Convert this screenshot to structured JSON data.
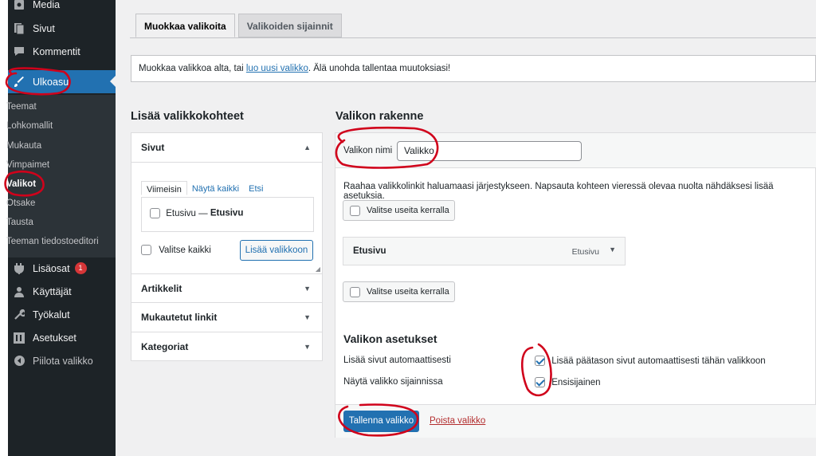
{
  "sidebar": {
    "items": [
      {
        "label": "Media",
        "icon": "media-icon"
      },
      {
        "label": "Sivut",
        "icon": "pages-icon"
      },
      {
        "label": "Kommentit",
        "icon": "comments-icon"
      },
      {
        "label": "Ulkoasu",
        "icon": "appearance-brush-icon"
      },
      {
        "label": "Lisäosat",
        "icon": "plugins-icon",
        "badge": "1"
      },
      {
        "label": "Käyttäjät",
        "icon": "users-icon"
      },
      {
        "label": "Työkalut",
        "icon": "tools-icon"
      },
      {
        "label": "Asetukset",
        "icon": "settings-icon"
      },
      {
        "label": "Piilota valikko",
        "icon": "collapse-menu-icon"
      }
    ],
    "submenu": [
      "Teemat",
      "Lohkomallit",
      "Mukauta",
      "Vimpaimet",
      "Valikot",
      "Otsake",
      "Tausta",
      "Teeman tiedostoeditori"
    ]
  },
  "tabs": [
    "Muokkaa valikoita",
    "Valikoiden sijainnit"
  ],
  "notice": {
    "before": "Muokkaa valikkoa alta, tai ",
    "link": "luo uusi valikko",
    "after": ". Älä unohda tallentaa muutoksiasi!"
  },
  "add_items": {
    "heading": "Lisää valikkokohteet",
    "sections": [
      "Sivut",
      "Artikkelit",
      "Mukautetut linkit",
      "Kategoriat"
    ],
    "inner_tabs": [
      "Viimeisin",
      "Näytä kaikki",
      "Etsi"
    ],
    "page_item_prefix": "Etusivu — ",
    "page_item_bold": "Etusivu",
    "select_all": "Valitse kaikki",
    "add_button": "Lisää valikkoon"
  },
  "structure": {
    "heading": "Valikon rakenne",
    "name_label": "Valikon nimi",
    "name_value": "Valikko",
    "instructions": "Raahaa valikkolinkit haluamaasi järjestykseen. Napsauta kohteen vieressä olevaa nuolta nähdäksesi lisää asetuksia.",
    "bulk_select": "Valitse useita kerralla",
    "menu_item_title": "Etusivu",
    "menu_item_type": "Etusivu"
  },
  "settings": {
    "heading": "Valikon asetukset",
    "auto_add_label": "Lisää sivut automaattisesti",
    "auto_add_option": "Lisää päätason sivut automaattisesti tähän valikkoon",
    "locations_label": "Näytä valikko sijainnissa",
    "location_option": "Ensisijainen"
  },
  "footer": {
    "save": "Tallenna valikko",
    "delete": "Poista valikko"
  },
  "colors": {
    "accent": "#2271b1",
    "sidebar": "#1d2327",
    "annotation": "#d0021b",
    "danger": "#b32d2e"
  }
}
